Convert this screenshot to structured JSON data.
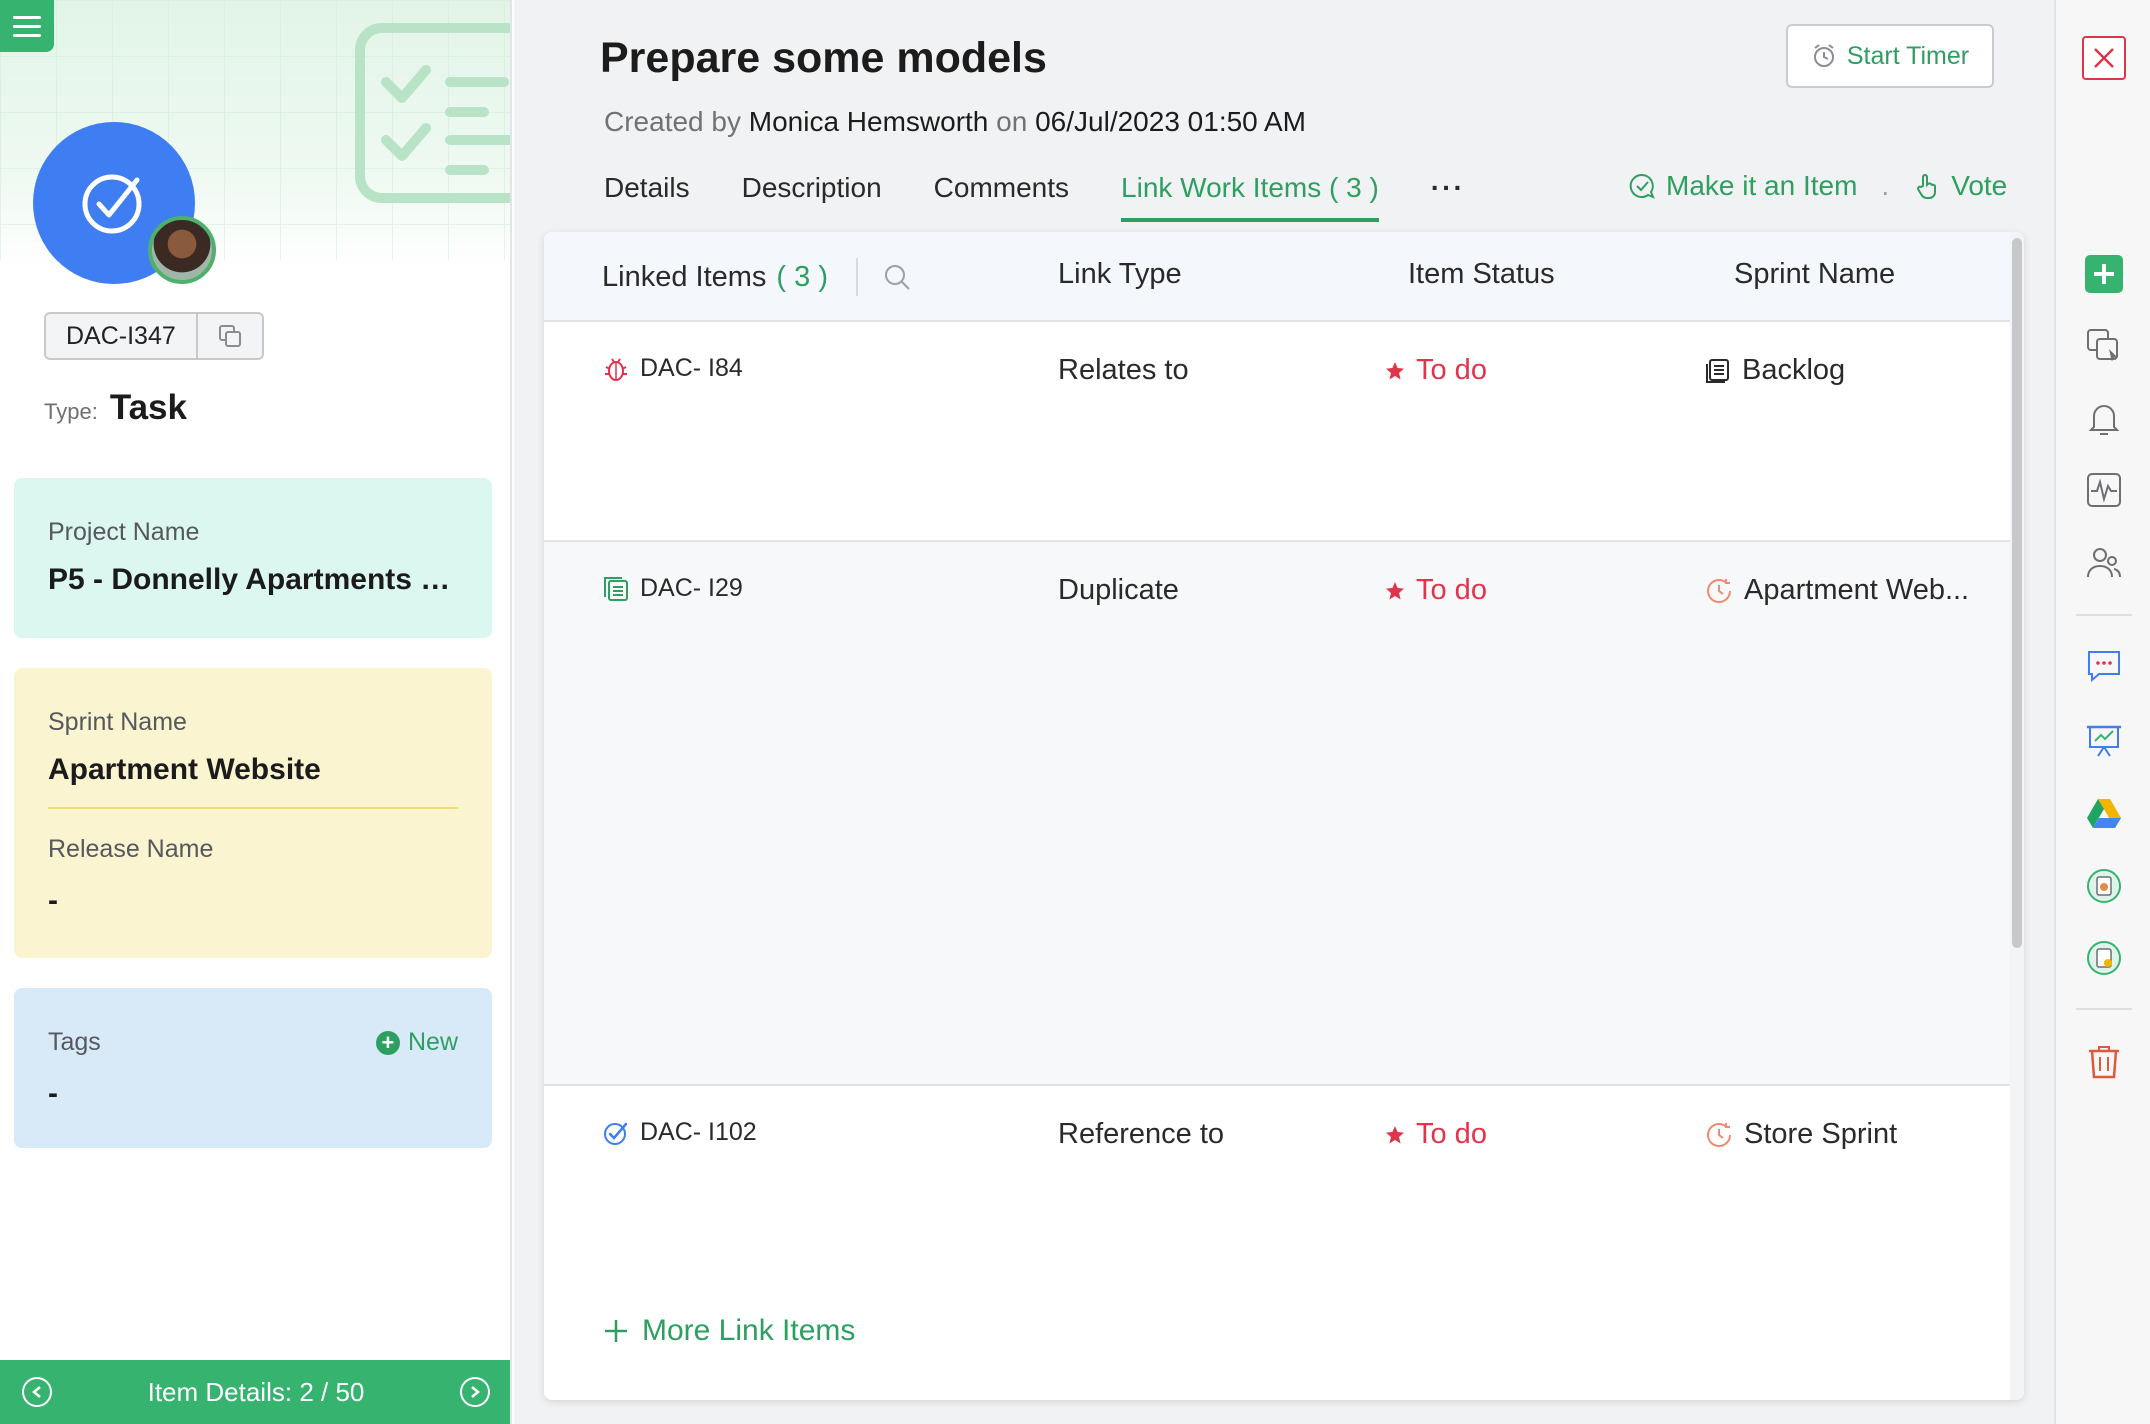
{
  "colors": {
    "brand_green": "#36b36f",
    "accent_green": "#2e9f61",
    "status_red": "#e0344b",
    "task_blue": "#3f7df2"
  },
  "left": {
    "item_id": "DAC-I347",
    "type_label": "Type:",
    "type_value": "Task",
    "project": {
      "label": "Project Name",
      "value": "P5 - Donnelly Apartments C..."
    },
    "sprint": {
      "label": "Sprint Name",
      "value": "Apartment Website"
    },
    "release": {
      "label": "Release Name",
      "value": "-"
    },
    "tags": {
      "label": "Tags",
      "new_label": "New",
      "value": "-"
    },
    "footer": {
      "label": "Item Details:",
      "position": "2 / 50"
    }
  },
  "header": {
    "title": "Prepare some models",
    "created_prefix": "Created by",
    "created_by": "Monica Hemsworth",
    "created_on_word": "on",
    "created_date": "06/Jul/2023 01:50 AM",
    "start_timer_label": "Start Timer"
  },
  "tabs": [
    {
      "label": "Details"
    },
    {
      "label": "Description"
    },
    {
      "label": "Comments"
    },
    {
      "label": "Link Work Items",
      "count": "( 3 )"
    }
  ],
  "tabs_more": "···",
  "actions": {
    "make_item": "Make it an Item",
    "separator": ".",
    "vote": "Vote"
  },
  "table": {
    "headers": {
      "linked": "Linked Items",
      "linked_count": "( 3 )",
      "link_type": "Link Type",
      "status": "Item Status",
      "sprint": "Sprint Name"
    },
    "rows": [
      {
        "icon": "bug-icon",
        "id": "DAC- I84",
        "link_type": "Relates to",
        "status": "To do",
        "sprint_icon": "backlog-icon",
        "sprint": "Backlog"
      },
      {
        "icon": "story-icon",
        "id": "DAC- I29",
        "link_type": "Duplicate",
        "status": "To do",
        "sprint_icon": "sprint-clock-icon",
        "sprint": "Apartment Web..."
      },
      {
        "icon": "task-icon",
        "id": "DAC- I102",
        "link_type": "Reference to",
        "status": "To do",
        "sprint_icon": "sprint-clock-icon",
        "sprint": "Store Sprint"
      }
    ],
    "more_link_label": "More Link Items"
  },
  "rail_icons": [
    "close-icon",
    "add-icon",
    "clone-icon",
    "bell-icon",
    "activity-icon",
    "users-icon",
    "chat-icon",
    "presentation-icon",
    "google-drive-icon",
    "app-icon",
    "app-icon-2",
    "trash-icon"
  ]
}
